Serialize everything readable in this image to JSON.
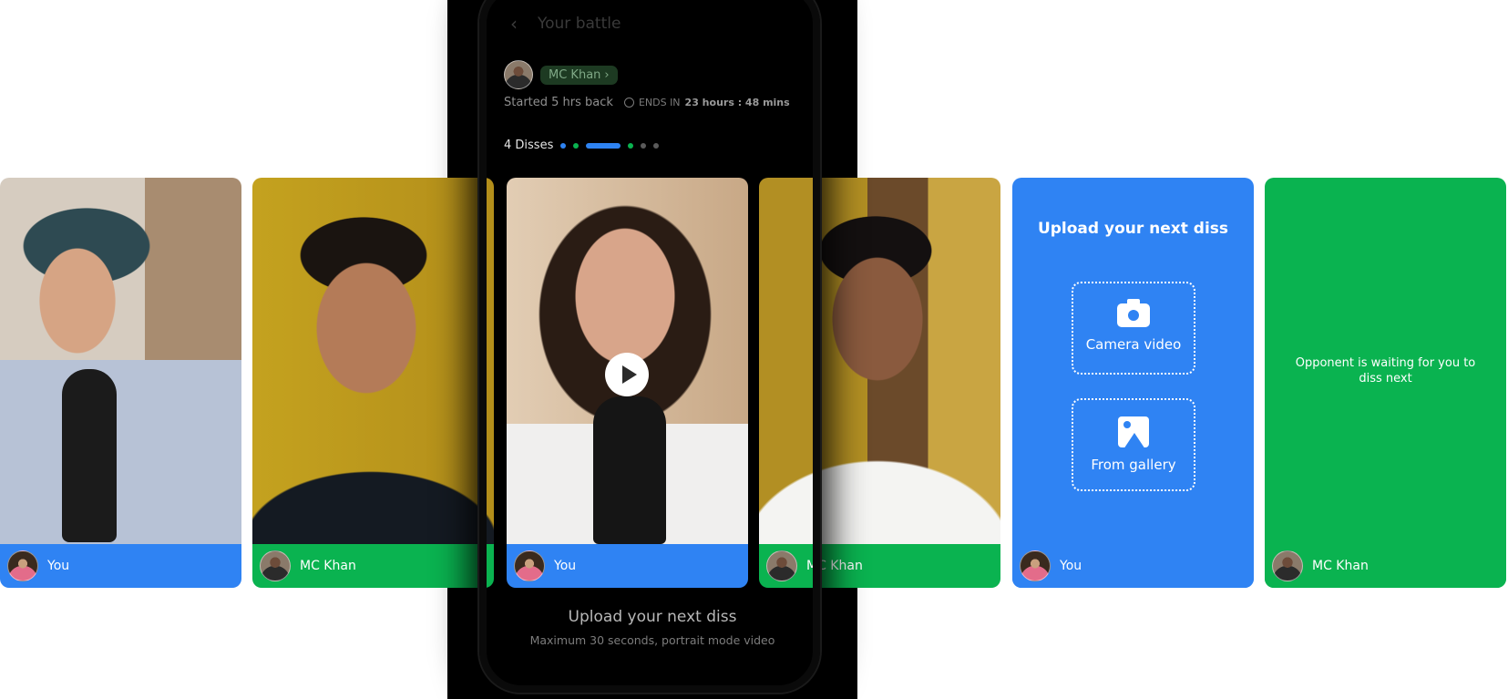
{
  "header": {
    "title": "Your battle"
  },
  "opponent": {
    "name": "MC Khan"
  },
  "battle": {
    "started": "Started 5 hrs back",
    "ends_label": "ENDS IN",
    "ends_value": "23 hours : 48 mins",
    "disses_label": "4 Disses",
    "progress_dot_colors": [
      "#2e83f2",
      "#0ab350",
      "#2e83f2",
      "#0ab350",
      "#5a5a5a",
      "#5a5a5a"
    ]
  },
  "cards": [
    {
      "type": "video",
      "owner": "You",
      "color": "blue"
    },
    {
      "type": "video",
      "owner": "MC Khan",
      "color": "green"
    },
    {
      "type": "video",
      "owner": "You",
      "color": "blue",
      "playing": false
    },
    {
      "type": "video",
      "owner": "MC Khan",
      "color": "green"
    },
    {
      "type": "upload",
      "owner": "You",
      "title": "Upload your next diss",
      "camera": "Camera video",
      "gallery": "From gallery"
    },
    {
      "type": "waiting",
      "owner": "MC Khan",
      "message": "Opponent is waiting for you to diss next"
    }
  ],
  "footer": {
    "title": "Upload your next diss",
    "subtitle": "Maximum 30 seconds, portrait mode video"
  },
  "colors": {
    "you": "#2f83f3",
    "opponent": "#0ab350"
  }
}
